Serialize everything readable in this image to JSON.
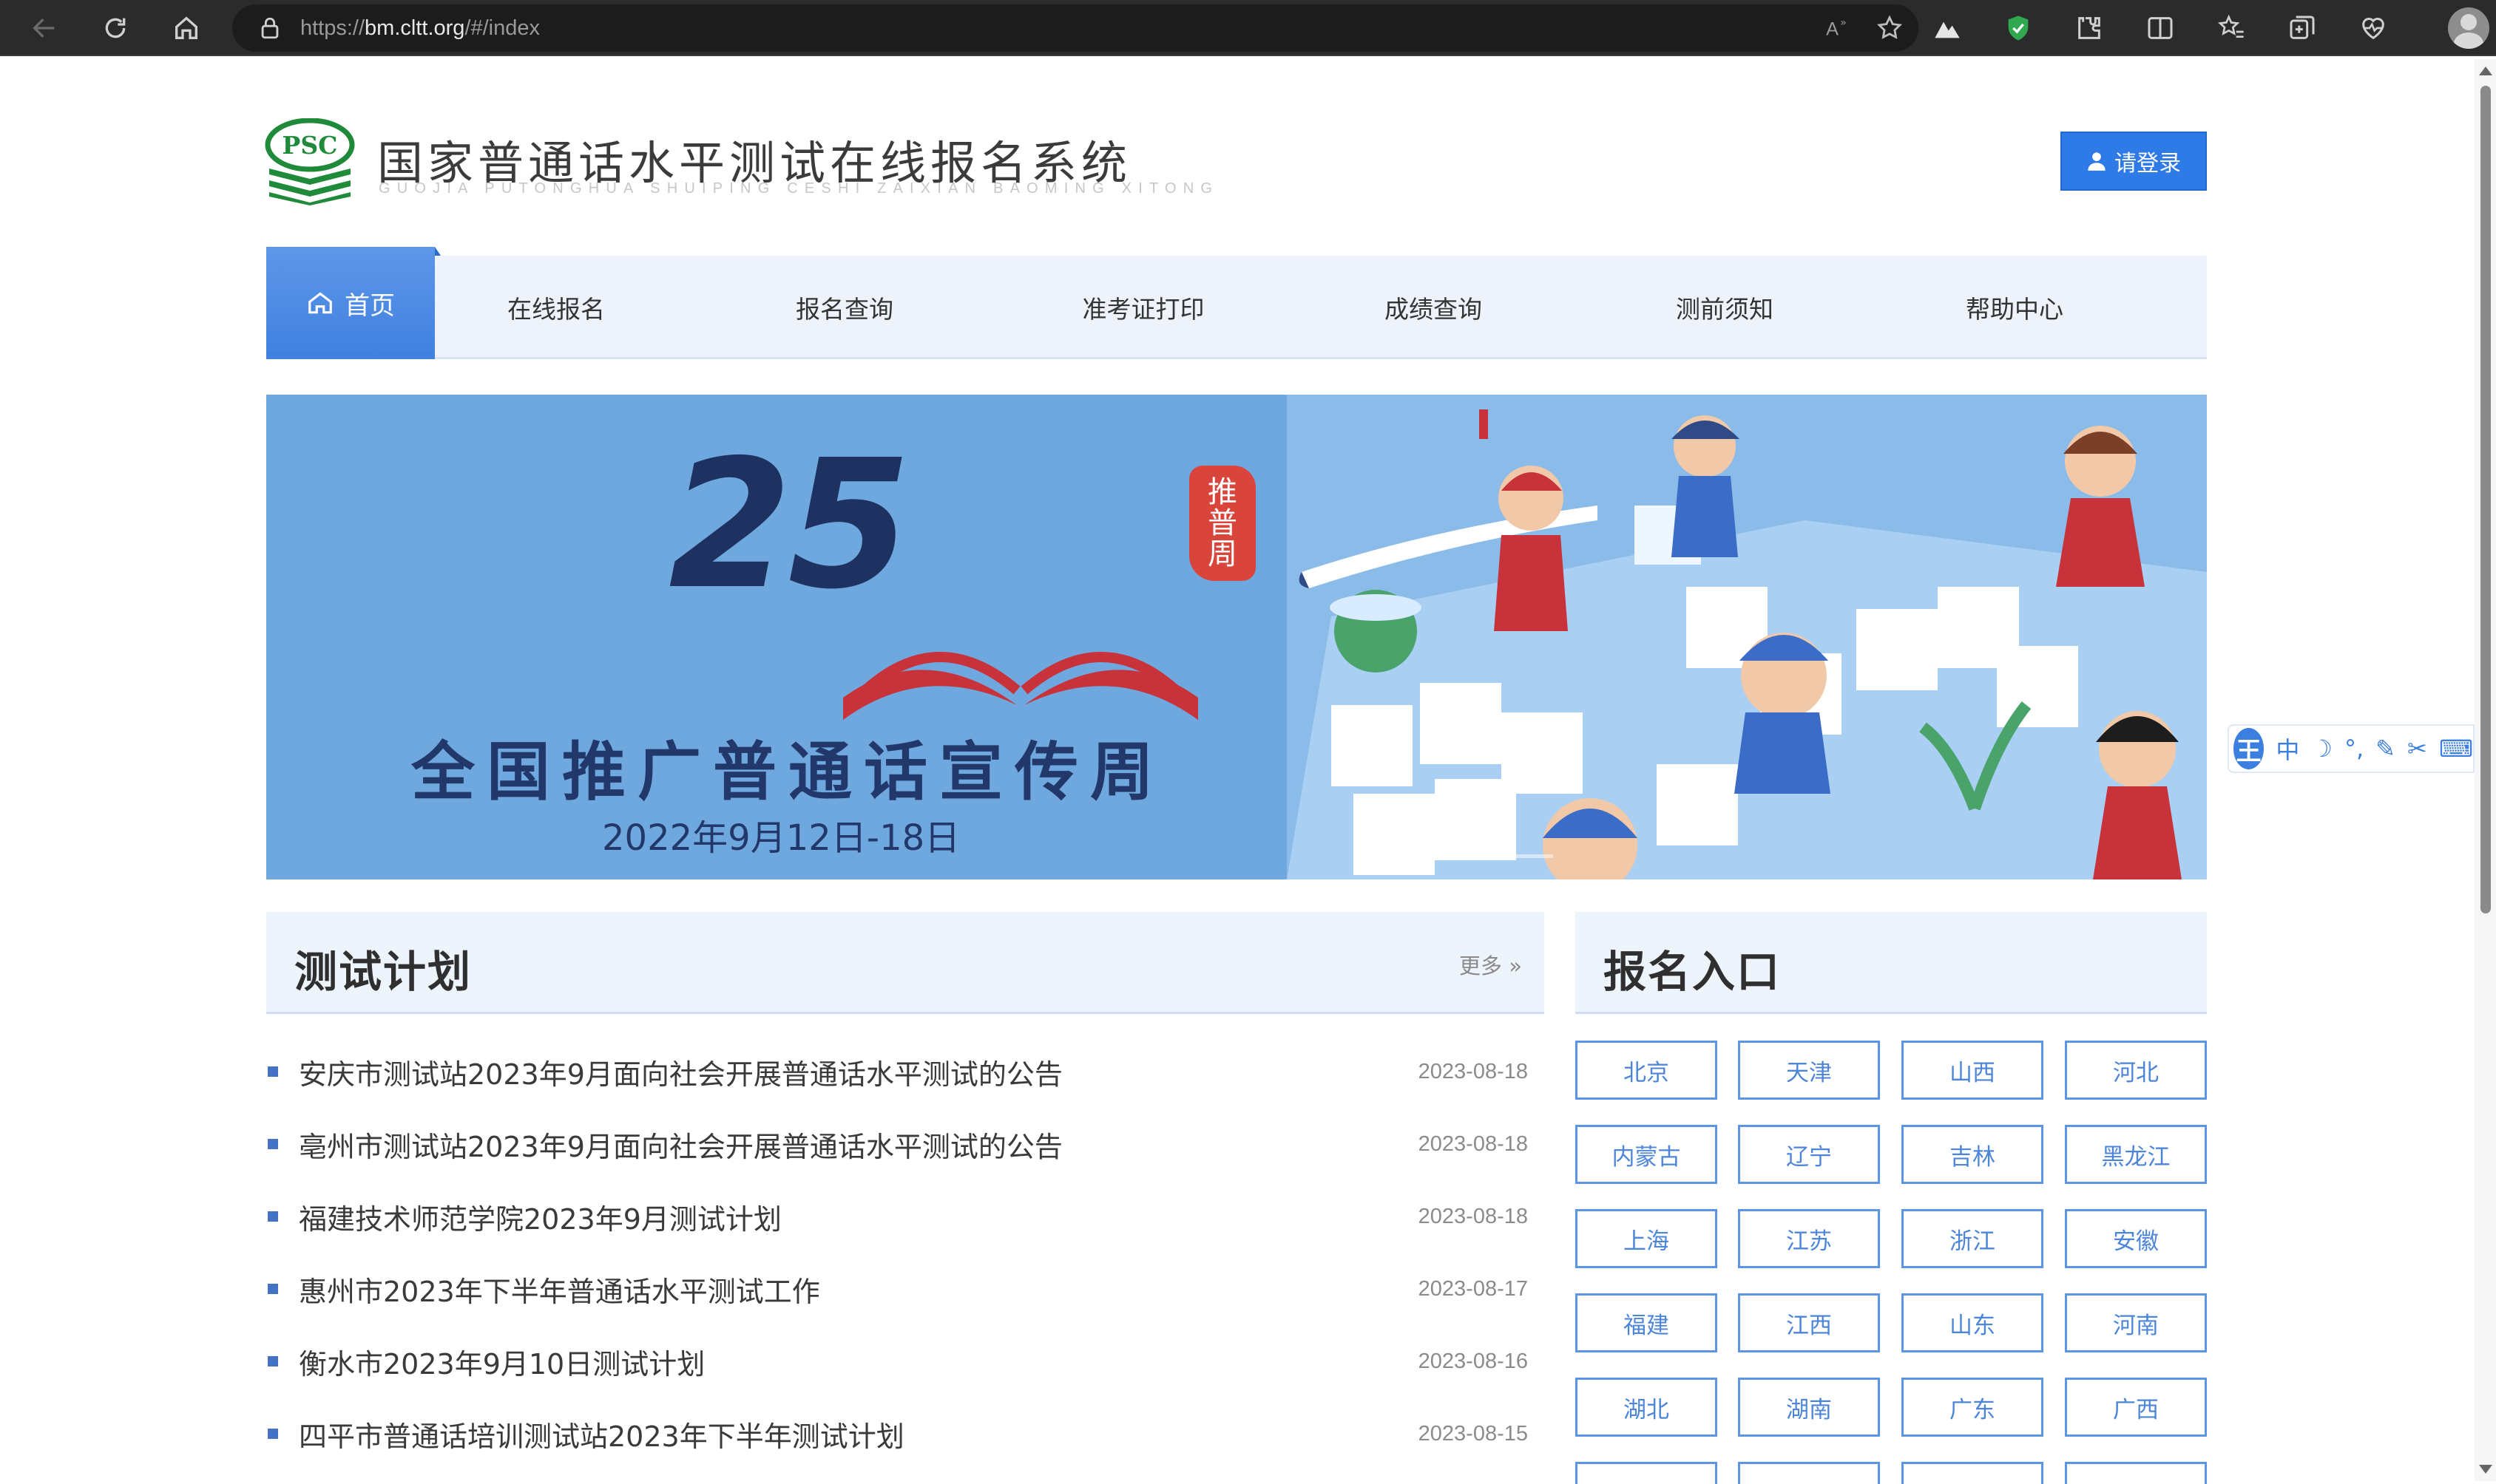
{
  "browser": {
    "url_prefix": "https://",
    "url_host": "bm.cltt.org",
    "url_path": "/#/index"
  },
  "header": {
    "title": "国家普通话水平测试在线报名系统",
    "subtitle": "GUOJIA PUTONGHUA SHUIPING CESHI ZAIXIAN BAOMING XITONG",
    "logo_text": "PSC",
    "login_label": "请登录"
  },
  "nav": {
    "home": "首页",
    "items": [
      "在线报名",
      "报名查询",
      "准考证打印",
      "成绩查询",
      "测前须知",
      "帮助中心"
    ]
  },
  "banner": {
    "number": "25",
    "seal": [
      "推",
      "普",
      "周"
    ],
    "title": "全国推广普通话宣传周",
    "date": "2022年9月12日-18日",
    "slides_total": 2,
    "slide_active": 1
  },
  "plan": {
    "title": "测试计划",
    "more": "更多 »",
    "items": [
      {
        "text": "安庆市测试站2023年9月面向社会开展普通话水平测试的公告",
        "date": "2023-08-18"
      },
      {
        "text": "亳州市测试站2023年9月面向社会开展普通话水平测试的公告",
        "date": "2023-08-18"
      },
      {
        "text": "福建技术师范学院2023年9月测试计划",
        "date": "2023-08-18"
      },
      {
        "text": "惠州市2023年下半年普通话水平测试工作",
        "date": "2023-08-17"
      },
      {
        "text": "衡水市2023年9月10日测试计划",
        "date": "2023-08-16"
      },
      {
        "text": "四平市普通话培训测试站2023年下半年测试计划",
        "date": "2023-08-15"
      }
    ]
  },
  "registration": {
    "title": "报名入口",
    "regions": [
      "北京",
      "天津",
      "山西",
      "河北",
      "内蒙古",
      "辽宁",
      "吉林",
      "黑龙江",
      "上海",
      "江苏",
      "浙江",
      "安徽",
      "福建",
      "江西",
      "山东",
      "河南",
      "湖北",
      "湖南",
      "广东",
      "广西"
    ]
  },
  "ime": {
    "logo": "王",
    "mode": "中"
  },
  "colors": {
    "primary": "#2e7ae6",
    "nav_bg": "#eef3fb",
    "banner_bg": "#6fa8de",
    "banner_text": "#22386a",
    "seal": "#d9453a"
  }
}
